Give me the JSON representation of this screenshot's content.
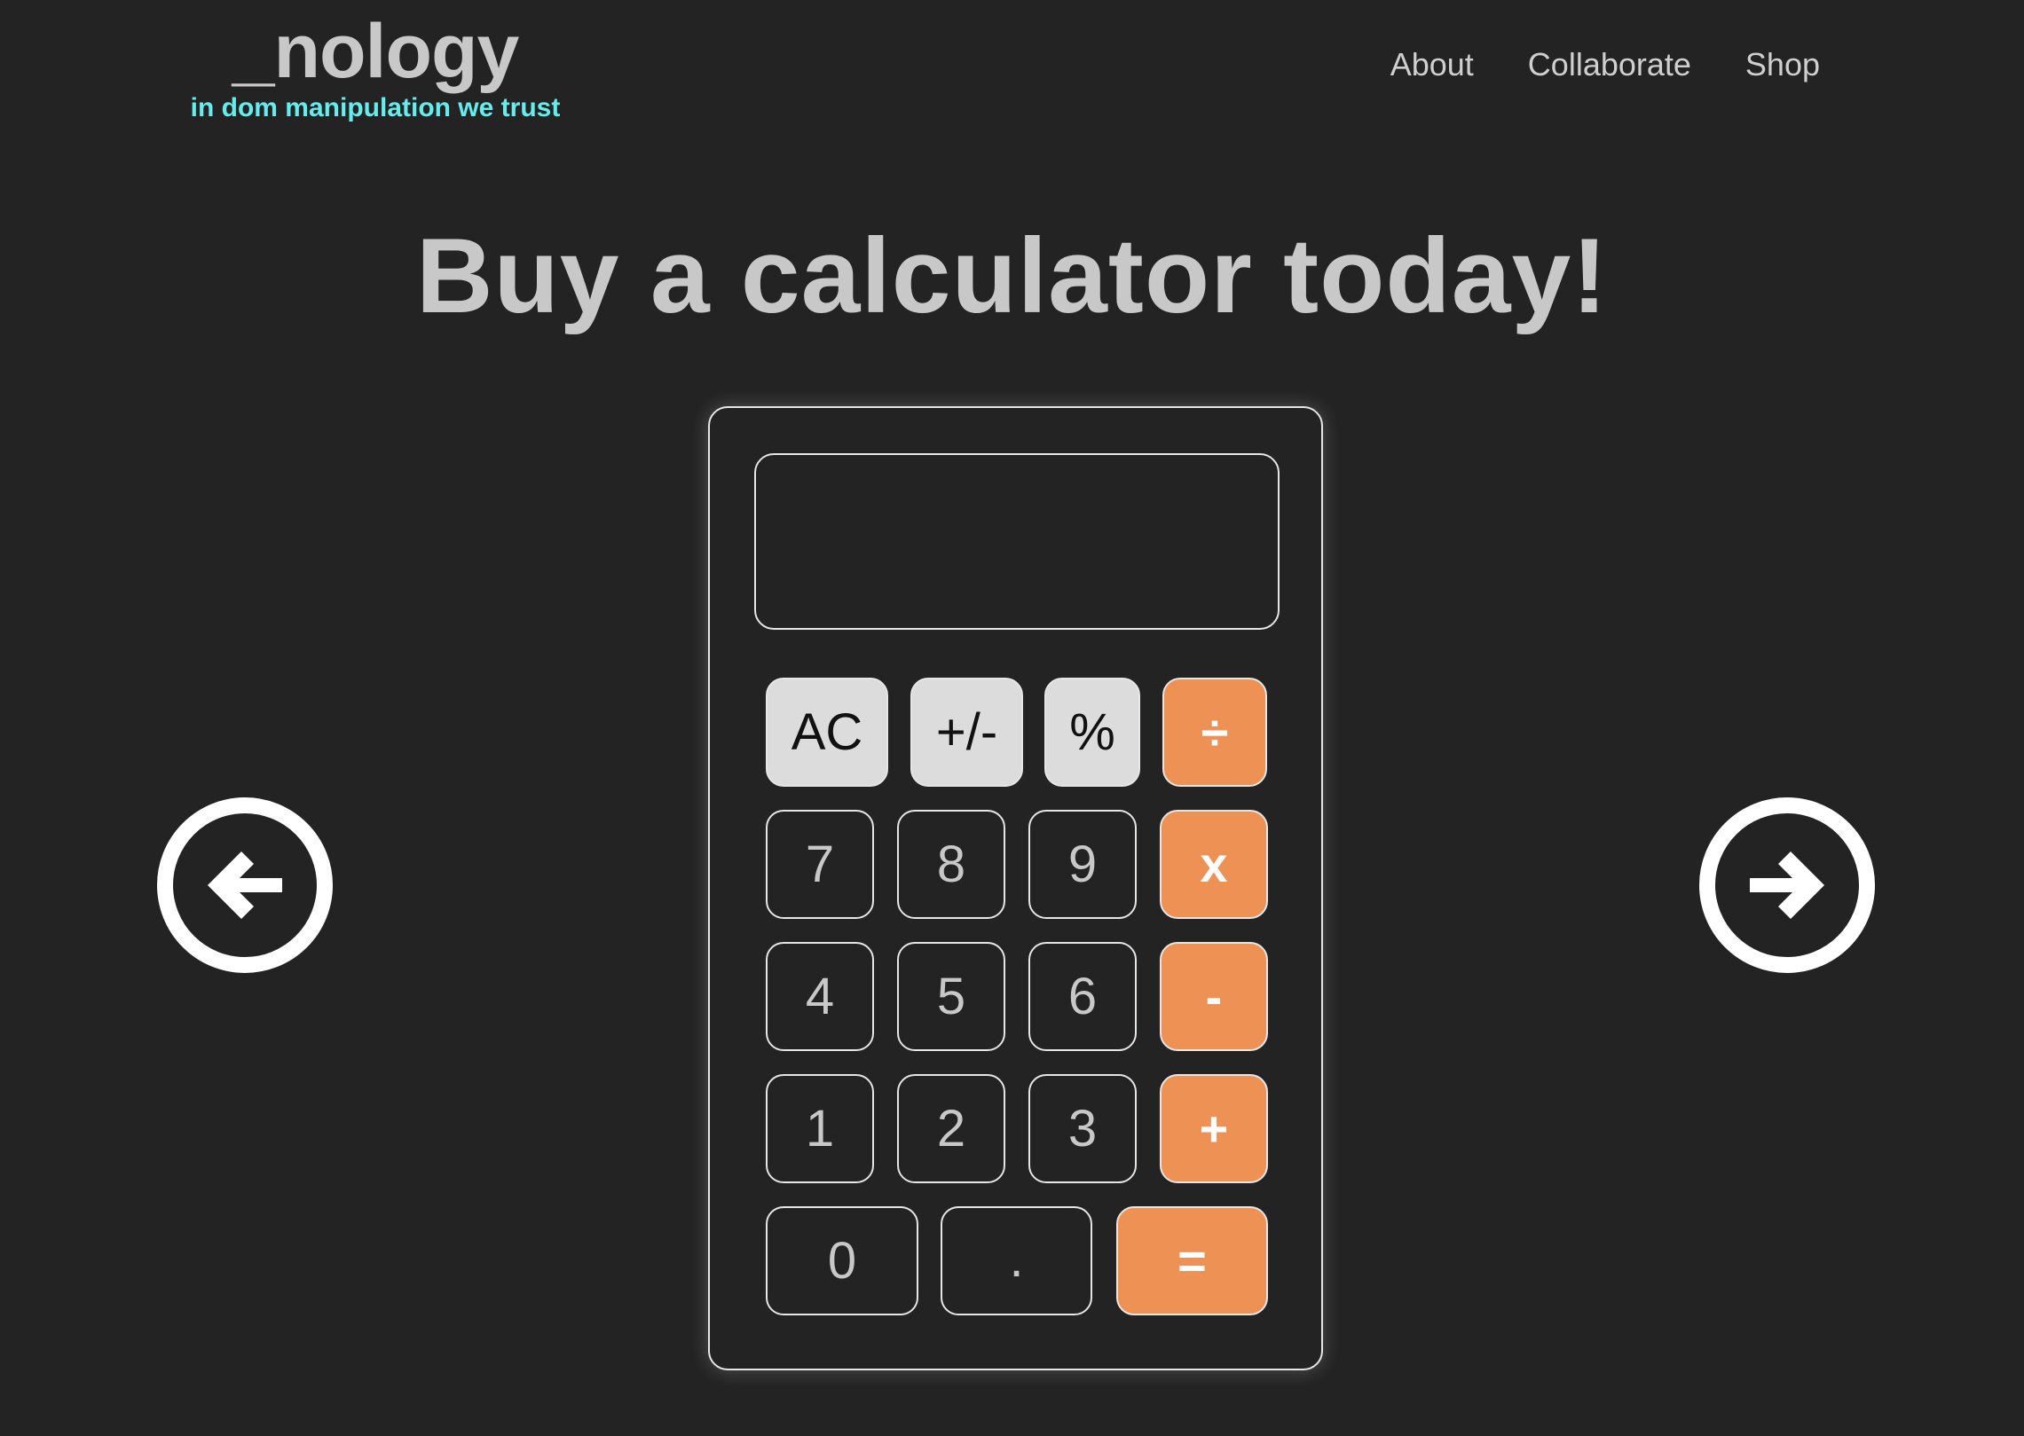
{
  "header": {
    "logo_title": "_nology",
    "logo_tagline": "in dom manipulation we trust",
    "nav": [
      "About",
      "Collaborate",
      "Shop"
    ]
  },
  "hero": {
    "headline": "Buy a calculator today!"
  },
  "carousel": {
    "prev_icon": "arrow-left-circle-icon",
    "next_icon": "arrow-right-circle-icon"
  },
  "calculator": {
    "display_value": "",
    "keys": {
      "clear": "AC",
      "sign": "+/-",
      "percent": "%",
      "divide": "÷",
      "seven": "7",
      "eight": "8",
      "nine": "9",
      "multiply": "x",
      "four": "4",
      "five": "5",
      "six": "6",
      "subtract": "-",
      "one": "1",
      "two": "2",
      "three": "3",
      "add": "+",
      "zero": "0",
      "decimal": ".",
      "equals": "="
    }
  },
  "colors": {
    "background": "#232323",
    "text": "#c8c8c8",
    "tagline": "#66ecec",
    "operator": "#ee9155",
    "function_key": "#dcdcdc"
  }
}
